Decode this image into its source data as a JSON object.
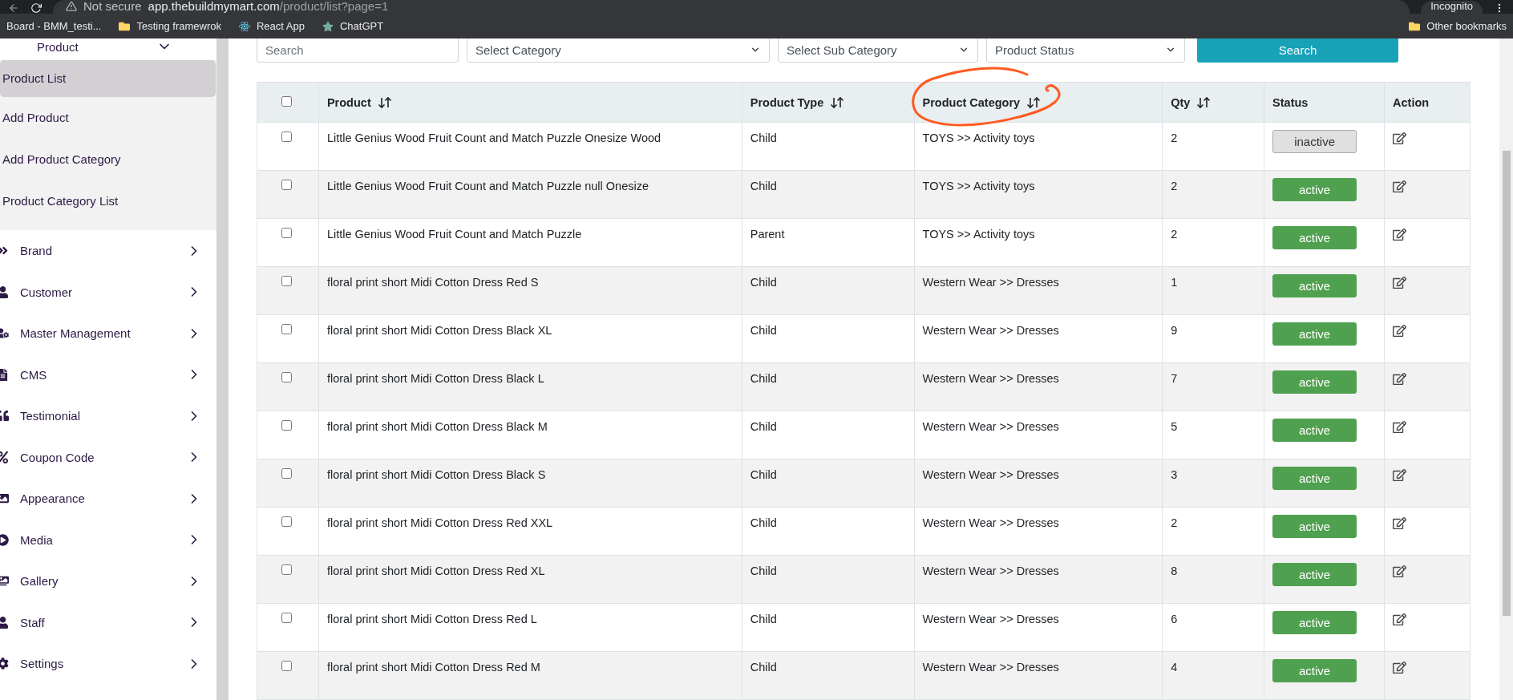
{
  "browser": {
    "security": "Not secure",
    "url_host": "app.thebuildmymart.com",
    "url_path": "/product/list?page=1",
    "profile": "Incognito",
    "bookmarks": [
      {
        "label": "Board - BMM_testi...",
        "kind": "site"
      },
      {
        "label": "Testing framewrok",
        "kind": "folder"
      },
      {
        "label": "React App",
        "kind": "react"
      },
      {
        "label": "ChatGPT",
        "kind": "chatgpt"
      }
    ],
    "other_bookmarks": "Other bookmarks"
  },
  "sidebar": {
    "group": {
      "label": "Product",
      "expanded": true,
      "children": [
        {
          "label": "Product List",
          "selected": true
        },
        {
          "label": "Add Product",
          "selected": false
        },
        {
          "label": "Add Product Category",
          "selected": false
        },
        {
          "label": "Product Category List",
          "selected": false
        }
      ]
    },
    "items": [
      {
        "label": "Brand"
      },
      {
        "label": "Customer"
      },
      {
        "label": "Master Management"
      },
      {
        "label": "CMS"
      },
      {
        "label": "Testimonial"
      },
      {
        "label": "Coupon Code"
      },
      {
        "label": "Appearance"
      },
      {
        "label": "Media"
      },
      {
        "label": "Gallery"
      },
      {
        "label": "Staff"
      },
      {
        "label": "Settings"
      }
    ]
  },
  "filters": {
    "search_placeholder": "Search",
    "selects": [
      "Select Category",
      "Select Sub Category",
      "Product Status"
    ],
    "button": "Search"
  },
  "table": {
    "select_all_checked": false,
    "columns": [
      {
        "label": "Product",
        "sortable": true,
        "circled": false
      },
      {
        "label": "Product Type",
        "sortable": true,
        "circled": false
      },
      {
        "label": "Product Category",
        "sortable": true,
        "circled": true
      },
      {
        "label": "Qty",
        "sortable": true,
        "circled": false
      },
      {
        "label": "Status",
        "sortable": false,
        "circled": false
      },
      {
        "label": "Action",
        "sortable": false,
        "circled": false
      }
    ],
    "rows": [
      {
        "checked": false,
        "product": "Little Genius Wood Fruit Count and Match Puzzle Onesize Wood",
        "type": "Child",
        "category": "TOYS >> Activity toys",
        "qty": "2",
        "status": "inactive",
        "active": false
      },
      {
        "checked": false,
        "product": "Little Genius Wood Fruit Count and Match Puzzle null Onesize",
        "type": "Child",
        "category": "TOYS >> Activity toys",
        "qty": "2",
        "status": "active",
        "active": true
      },
      {
        "checked": false,
        "product": "Little Genius Wood Fruit Count and Match Puzzle",
        "type": "Parent",
        "category": "TOYS >> Activity toys",
        "qty": "2",
        "status": "active",
        "active": true
      },
      {
        "checked": false,
        "product": "floral print short Midi Cotton Dress Red S",
        "type": "Child",
        "category": "Western Wear >> Dresses",
        "qty": "1",
        "status": "active",
        "active": true
      },
      {
        "checked": false,
        "product": "floral print short Midi Cotton Dress Black XL",
        "type": "Child",
        "category": "Western Wear >> Dresses",
        "qty": "9",
        "status": "active",
        "active": true
      },
      {
        "checked": false,
        "product": "floral print short Midi Cotton Dress Black L",
        "type": "Child",
        "category": "Western Wear >> Dresses",
        "qty": "7",
        "status": "active",
        "active": true
      },
      {
        "checked": false,
        "product": "floral print short Midi Cotton Dress Black M",
        "type": "Child",
        "category": "Western Wear >> Dresses",
        "qty": "5",
        "status": "active",
        "active": true
      },
      {
        "checked": false,
        "product": "floral print short Midi Cotton Dress Black S",
        "type": "Child",
        "category": "Western Wear >> Dresses",
        "qty": "3",
        "status": "active",
        "active": true
      },
      {
        "checked": false,
        "product": "floral print short Midi Cotton Dress Red XXL",
        "type": "Child",
        "category": "Western Wear >> Dresses",
        "qty": "2",
        "status": "active",
        "active": true
      },
      {
        "checked": false,
        "product": "floral print short Midi Cotton Dress Red XL",
        "type": "Child",
        "category": "Western Wear >> Dresses",
        "qty": "8",
        "status": "active",
        "active": true
      },
      {
        "checked": false,
        "product": "floral print short Midi Cotton Dress Red L",
        "type": "Child",
        "category": "Western Wear >> Dresses",
        "qty": "6",
        "status": "active",
        "active": true
      },
      {
        "checked": false,
        "product": "floral print short Midi Cotton Dress Red M",
        "type": "Child",
        "category": "Western Wear >> Dresses",
        "qty": "4",
        "status": "active",
        "active": true
      }
    ]
  }
}
